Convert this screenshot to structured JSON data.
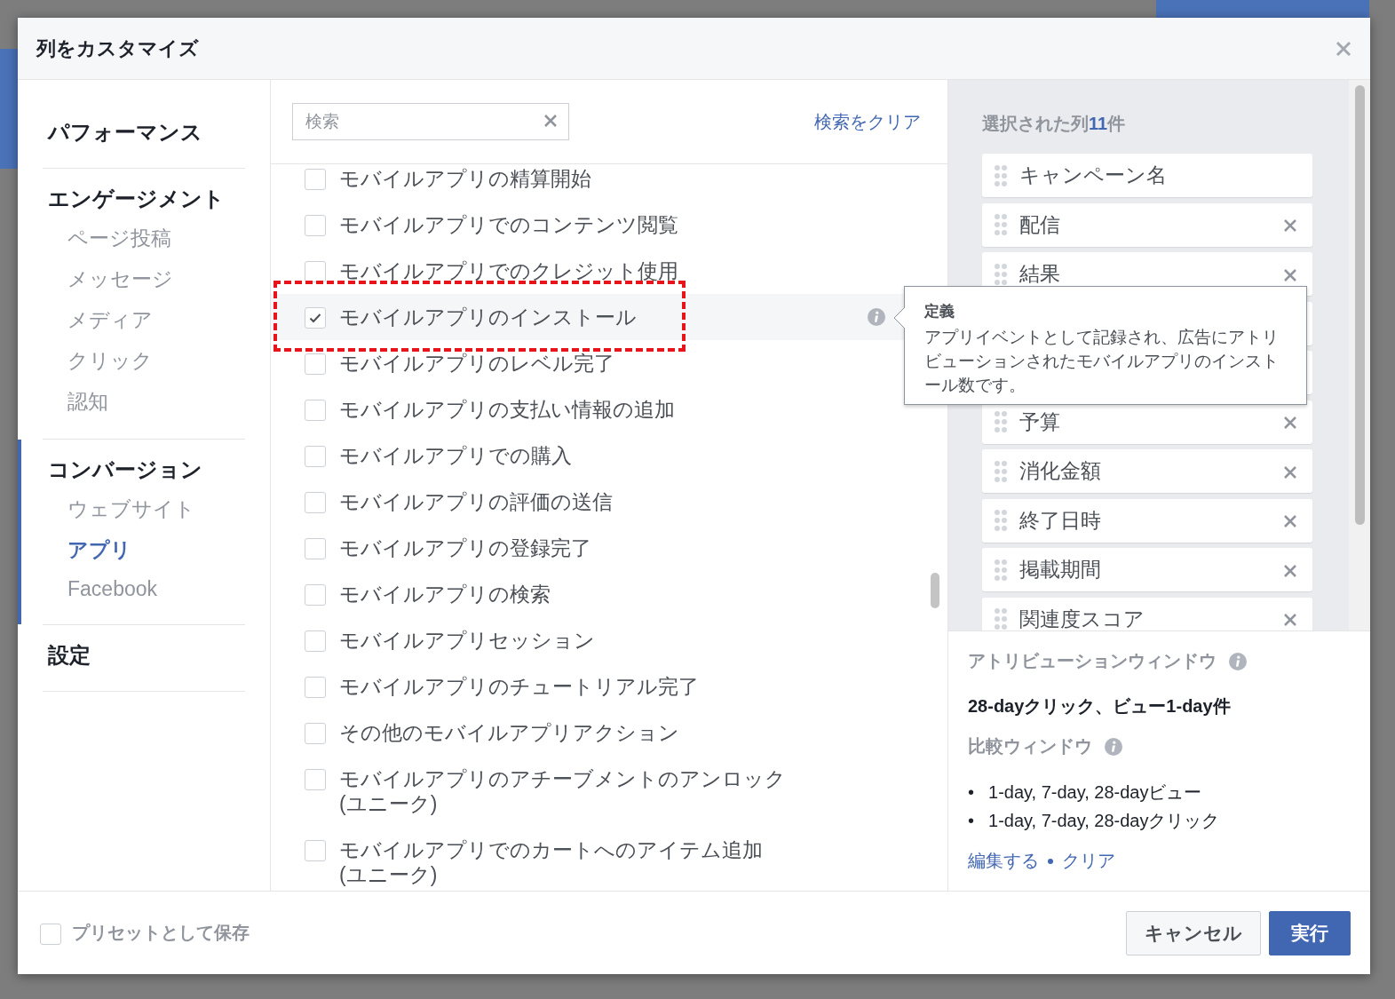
{
  "dialog": {
    "title": "列をカスタマイズ"
  },
  "nav": [
    {
      "heading": "パフォーマンス",
      "active": false
    },
    {
      "heading": "エンゲージメント",
      "active": false,
      "items": [
        {
          "label": "ページ投稿",
          "selected": false
        },
        {
          "label": "メッセージ",
          "selected": false
        },
        {
          "label": "メディア",
          "selected": false
        },
        {
          "label": "クリック",
          "selected": false
        },
        {
          "label": "認知",
          "selected": false
        }
      ]
    },
    {
      "heading": "コンバージョン",
      "active": true,
      "items": [
        {
          "label": "ウェブサイト",
          "selected": false
        },
        {
          "label": "アプリ",
          "selected": true
        },
        {
          "label": "Facebook",
          "selected": false
        }
      ]
    },
    {
      "heading": "設定",
      "active": false
    }
  ],
  "search": {
    "placeholder": "検索",
    "clear_link": "検索をクリア"
  },
  "metrics": [
    {
      "label": "モバイルアプリの精算開始",
      "checked": false,
      "highlighted": false
    },
    {
      "label": "モバイルアプリでのコンテンツ閲覧",
      "checked": false,
      "highlighted": false
    },
    {
      "label": "モバイルアプリでのクレジット使用",
      "checked": false,
      "highlighted": false
    },
    {
      "label": "モバイルアプリのインストール",
      "checked": true,
      "highlighted": true
    },
    {
      "label": "モバイルアプリのレベル完了",
      "checked": false,
      "highlighted": false
    },
    {
      "label": "モバイルアプリの支払い情報の追加",
      "checked": false,
      "highlighted": false
    },
    {
      "label": "モバイルアプリでの購入",
      "checked": false,
      "highlighted": false
    },
    {
      "label": "モバイルアプリの評価の送信",
      "checked": false,
      "highlighted": false
    },
    {
      "label": "モバイルアプリの登録完了",
      "checked": false,
      "highlighted": false
    },
    {
      "label": "モバイルアプリの検索",
      "checked": false,
      "highlighted": false
    },
    {
      "label": "モバイルアプリセッション",
      "checked": false,
      "highlighted": false
    },
    {
      "label": "モバイルアプリのチュートリアル完了",
      "checked": false,
      "highlighted": false
    },
    {
      "label": "その他のモバイルアプリアクション",
      "checked": false,
      "highlighted": false
    },
    {
      "label": "モバイルアプリのアチーブメントのアンロック(ユニーク)",
      "checked": false,
      "highlighted": false
    },
    {
      "label": "モバイルアプリでのカートへのアイテム追加(ユニーク)",
      "checked": false,
      "highlighted": false
    }
  ],
  "tooltip": {
    "title": "定義",
    "text": "アプリイベントとして記録され、広告にアトリビューションされたモバイルアプリのインストール数です。"
  },
  "selected_columns": {
    "heading": "選択された列",
    "count": "11",
    "suffix": "件",
    "items": [
      {
        "kind": "column",
        "label": "キャンペーン名",
        "removable": false
      },
      {
        "kind": "column",
        "label": "配信",
        "removable": true
      },
      {
        "kind": "column",
        "label": "結果",
        "removable": true
      },
      {
        "kind": "covered"
      },
      {
        "kind": "covered"
      },
      {
        "kind": "column",
        "label": "予算",
        "removable": true
      },
      {
        "kind": "column",
        "label": "消化金額",
        "removable": true
      },
      {
        "kind": "column",
        "label": "終了日時",
        "removable": true
      },
      {
        "kind": "column",
        "label": "掲載期間",
        "removable": true
      },
      {
        "kind": "column",
        "label": "関連度スコア",
        "removable": true
      }
    ]
  },
  "attribution": {
    "heading": "アトリビューションウィンドウ",
    "value": "28-dayクリック、ビュー1-day件",
    "comparison_heading": "比較ウィンドウ",
    "comparison_items": [
      {
        "bullet": "•",
        "text": "1-day, 7-day, 28-dayビュー"
      },
      {
        "bullet": "•",
        "text": "1-day, 7-day, 28-dayクリック"
      }
    ],
    "links": [
      "編集する",
      "クリア"
    ]
  },
  "footer": {
    "preset_label": "プリセットとして保存",
    "preset_checked": false,
    "buttons": [
      {
        "label": "キャンセル",
        "kind": "secondary"
      },
      {
        "label": "実行",
        "kind": "primary"
      }
    ]
  }
}
